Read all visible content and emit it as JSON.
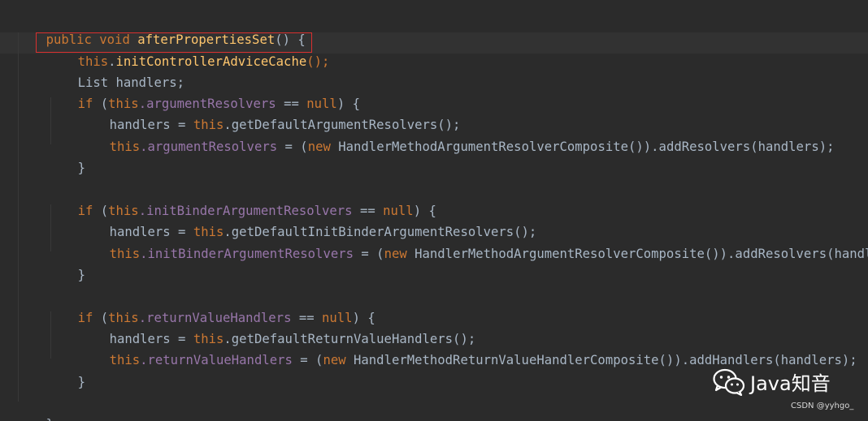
{
  "code": {
    "line1": {
      "kw": "public void",
      "method": "afterPropertiesSet",
      "rest": "() {"
    },
    "line2": {
      "kw": "this",
      "dot": ".",
      "method": "initControllerAdviceCache",
      "rest": "();"
    },
    "line3": {
      "text": "List handlers;"
    },
    "line4": {
      "kw_if": "if",
      "p1": " (",
      "kw_this": "this",
      "field": ".argumentResolvers",
      "op": " == ",
      "kw_null": "null",
      "rest": ") {"
    },
    "line5": {
      "lhs": "handlers = ",
      "kw_this": "this",
      "rest": ".getDefaultArgumentResolvers();"
    },
    "line6": {
      "kw_this": "this",
      "field": ".argumentResolvers",
      "mid": " = (",
      "kw_new": "new",
      "rest": " HandlerMethodArgumentResolverComposite()).addResolvers(handlers);"
    },
    "line7": {
      "text": "}"
    },
    "line9": {
      "kw_if": "if",
      "p1": " (",
      "kw_this": "this",
      "field": ".initBinderArgumentResolvers",
      "op": " == ",
      "kw_null": "null",
      "rest": ") {"
    },
    "line10": {
      "lhs": "handlers = ",
      "kw_this": "this",
      "rest": ".getDefaultInitBinderArgumentResolvers();"
    },
    "line11": {
      "kw_this": "this",
      "field": ".initBinderArgumentResolvers",
      "mid": " = (",
      "kw_new": "new",
      "rest": " HandlerMethodArgumentResolverComposite()).addResolvers(handl"
    },
    "line12": {
      "text": "}"
    },
    "line14": {
      "kw_if": "if",
      "p1": " (",
      "kw_this": "this",
      "field": ".returnValueHandlers",
      "op": " == ",
      "kw_null": "null",
      "rest": ") {"
    },
    "line15": {
      "lhs": "handlers = ",
      "kw_this": "this",
      "rest": ".getDefaultReturnValueHandlers();"
    },
    "line16": {
      "kw_this": "this",
      "field": ".returnValueHandlers",
      "mid": " = (",
      "kw_new": "new",
      "rest": " HandlerMethodReturnValueHandlerComposite()).addHandlers(handlers);"
    },
    "line17": {
      "text": "}"
    },
    "line19": {
      "text": "}"
    }
  },
  "watermark": {
    "label": "Java知音",
    "icon": "wechat-icon"
  },
  "credit": "CSDN @yyhgo_",
  "colors": {
    "background": "#2b2b2b",
    "keyword": "#cc7832",
    "field": "#9876aa",
    "method": "#ffc66d",
    "plain": "#a9b7c6",
    "callout": "#d9302f"
  }
}
